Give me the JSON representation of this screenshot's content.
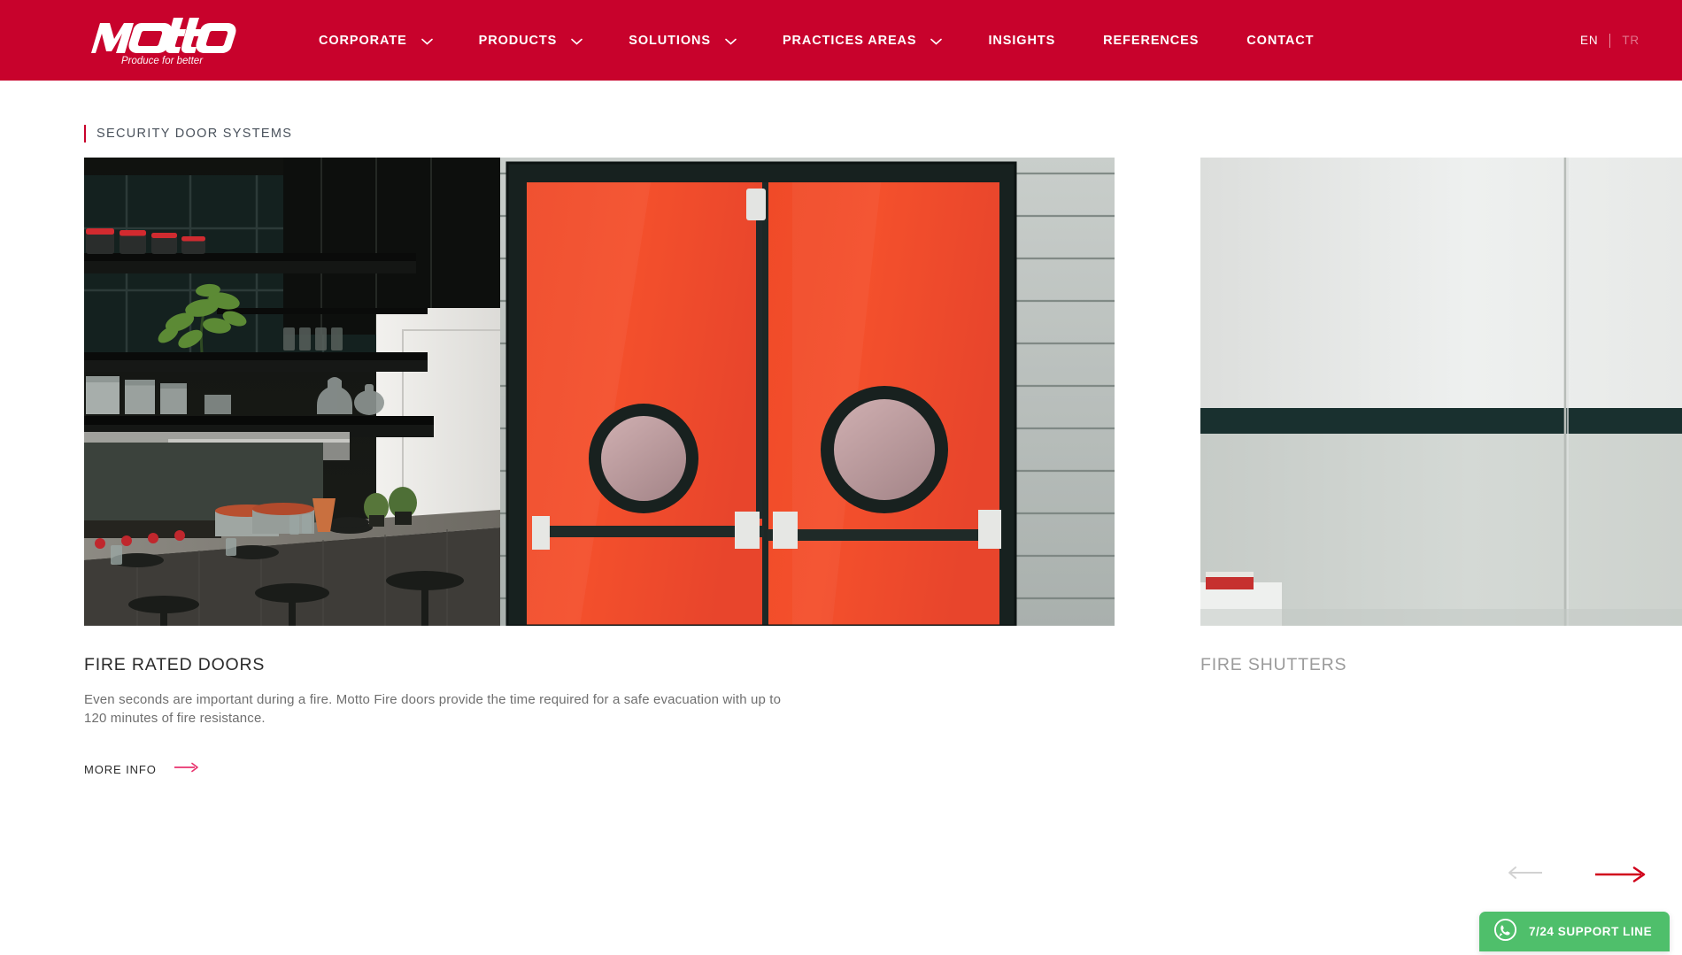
{
  "brand": {
    "name": "MOTTO",
    "tagline": "Produce for better",
    "header_color": "#C8022C",
    "accent_color": "#C8022C",
    "link_arrow_color": "#E8336E"
  },
  "nav": {
    "items": [
      {
        "label": "CORPORATE",
        "has_dropdown": true,
        "icon": "chevron-down-icon"
      },
      {
        "label": "PRODUCTS",
        "has_dropdown": true,
        "icon": "chevron-down-icon"
      },
      {
        "label": "SOLUTIONS",
        "has_dropdown": true,
        "icon": "chevron-down-icon"
      },
      {
        "label": "PRACTICES AREAS",
        "has_dropdown": true,
        "icon": "chevron-down-icon"
      },
      {
        "label": "INSIGHTS",
        "has_dropdown": false
      },
      {
        "label": "REFERENCES",
        "has_dropdown": false
      },
      {
        "label": "CONTACT",
        "has_dropdown": false
      }
    ]
  },
  "language": {
    "active": "EN",
    "inactive": "TR"
  },
  "section": {
    "title": "SECURITY DOOR SYSTEMS"
  },
  "slider": {
    "cards": [
      {
        "title": "FIRE RATED DOORS",
        "description": "Even seconds are important during a fire. Motto Fire doors provide the time required for a safe evacuation with up to 120 minutes of fire resistance.",
        "cta_label": "MORE INFO",
        "cta_icon": "arrow-right-icon",
        "image_alt": "Red double fire rated doors with porthole windows in a dark kitchen"
      },
      {
        "title": "FIRE SHUTTERS",
        "description": "",
        "cta_label": "",
        "image_alt": "Metal rolling fire shutter next to white wall panels"
      }
    ],
    "prev_icon": "arrow-left-icon",
    "next_icon": "arrow-right-icon",
    "prev_enabled": false,
    "next_enabled": true
  },
  "support": {
    "label": "7/24 SUPPORT LINE",
    "icon": "whatsapp-icon",
    "color": "#4FBF6B"
  }
}
